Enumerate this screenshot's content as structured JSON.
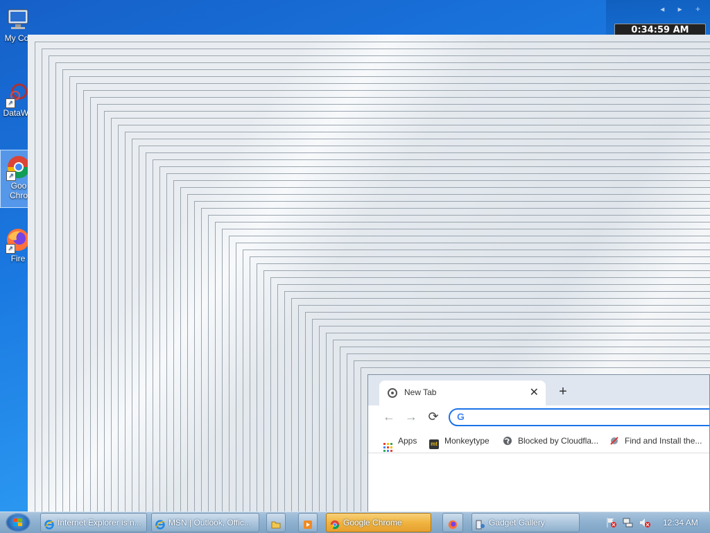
{
  "desktop": {
    "icons": [
      {
        "label": "My Cor",
        "icon": "computer-icon"
      },
      {
        "label": "DataWa",
        "icon": "datawarrior-icon"
      },
      {
        "label": "Goo Chro",
        "icon": "chrome-icon"
      },
      {
        "label": "Fire",
        "icon": "firefox-icon"
      }
    ]
  },
  "gadget": {
    "clock_text": "0:34:59 AM",
    "nav": "◂ ▸ +"
  },
  "chrome_window": {
    "tab_title": "New Tab",
    "tab_close": "✕",
    "new_tab": "+",
    "omnibox_value": "",
    "bookmarks": [
      {
        "label": "Apps",
        "icon": "apps-grid-icon"
      },
      {
        "label": "Monkeytype",
        "icon": "monkeytype-icon",
        "badge": "mt"
      },
      {
        "label": "Blocked by Cloudfla...",
        "icon": "globe-icon"
      },
      {
        "label": "Find and Install the...",
        "icon": "gadget-icon"
      }
    ]
  },
  "taskbar": {
    "buttons": [
      {
        "label": "Internet Explorer is n...",
        "icon": "ie-icon"
      },
      {
        "label": "MSN | Outlook, Offic...",
        "icon": "ie-icon"
      },
      {
        "label": "",
        "icon": "explorer-folder-icon"
      },
      {
        "label": "",
        "icon": "media-player-icon"
      },
      {
        "label": "Google Chrome",
        "icon": "chrome-icon"
      },
      {
        "label": "",
        "icon": "firefox-icon"
      },
      {
        "label": "Gadget Gallery",
        "icon": "gadget-gallery-icon"
      }
    ],
    "time": "12:34 AM"
  },
  "colors": {
    "accent": "#1a73e8",
    "taskbar_active": "#f0b440"
  }
}
